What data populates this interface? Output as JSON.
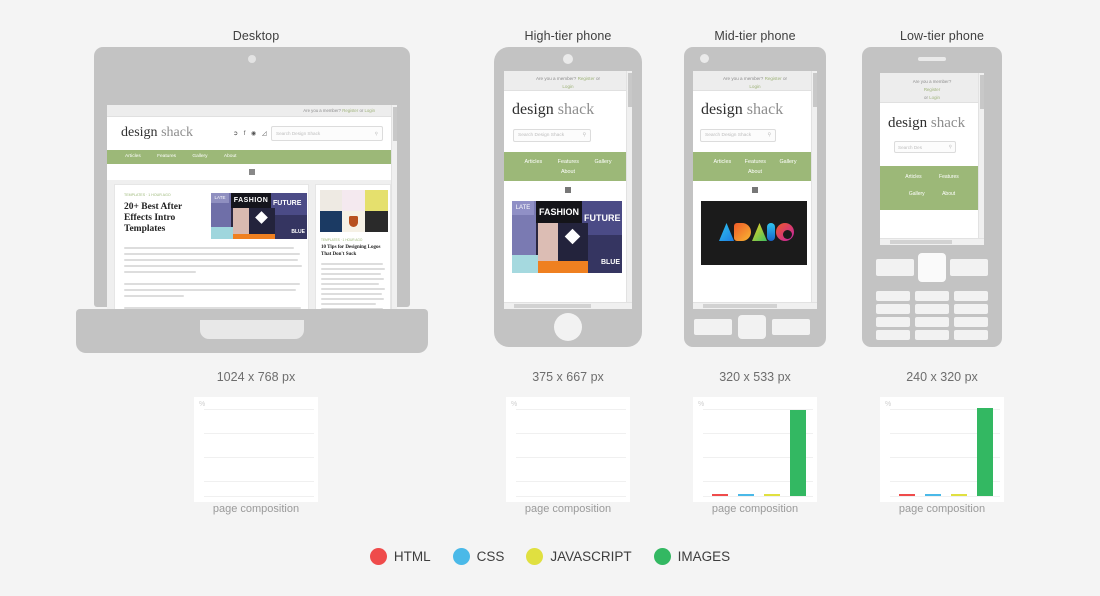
{
  "columns": [
    {
      "title": "Desktop",
      "size": "1024 x 768 px"
    },
    {
      "title": "High-tier phone",
      "size": "375 x 667 px"
    },
    {
      "title": "Mid-tier phone",
      "size": "320 x 533 px"
    },
    {
      "title": "Low-tier phone",
      "size": "240 x 320 px"
    }
  ],
  "site": {
    "topbar_text": "Are you a member?",
    "register_label": "Register",
    "or_label": "or",
    "login_label": "Login",
    "logo_first": "design",
    "logo_second": "shack",
    "search_placeholder": "Search Design Shack",
    "search_placeholder_short": "Search Des",
    "search_icon": "search-icon",
    "nav": [
      "Articles",
      "Features",
      "Gallery",
      "About"
    ],
    "social_icons": [
      "twitter-icon",
      "facebook-icon",
      "google-plus-icon",
      "rss-icon"
    ],
    "articles": [
      {
        "kicker": "TEMPLATES · 1 HOUR AGO",
        "headline": "20+ Best After Effects Intro Templates"
      },
      {
        "kicker": "TEMPLATES · 1 HOUR AGO",
        "headline": "10 Tips for Designing Logos That Don't Suck"
      }
    ],
    "collage_words": [
      "FASHION",
      "FUTURE",
      "LATE",
      "BLUE"
    ],
    "mid_image_caption": "ASVIO"
  },
  "legend": [
    {
      "label": "HTML",
      "color": "#ef4b4b"
    },
    {
      "label": "CSS",
      "color": "#4ab9e8"
    },
    {
      "label": "JAVASCRIPT",
      "color": "#e0e040"
    },
    {
      "label": "IMAGES",
      "color": "#33b862"
    }
  ],
  "chart_caption": "page composition",
  "chart_ylabel": "%",
  "chart_data": [
    {
      "type": "bar",
      "title": "Desktop",
      "categories": [
        "HTML",
        "CSS",
        "JAVASCRIPT",
        "IMAGES"
      ],
      "values": [
        0,
        0,
        0,
        0
      ],
      "colors": [
        "#ef4b4b",
        "#4ab9e8",
        "#e0e040",
        "#33b862"
      ],
      "xlabel": "page composition",
      "ylabel": "%",
      "ylim": [
        0,
        100
      ],
      "grid": true,
      "legend_position": "bottom"
    },
    {
      "type": "bar",
      "title": "High-tier phone",
      "categories": [
        "HTML",
        "CSS",
        "JAVASCRIPT",
        "IMAGES"
      ],
      "values": [
        0,
        0,
        0,
        0
      ],
      "colors": [
        "#ef4b4b",
        "#4ab9e8",
        "#e0e040",
        "#33b862"
      ],
      "xlabel": "page composition",
      "ylabel": "%",
      "ylim": [
        0,
        100
      ],
      "grid": true,
      "legend_position": "bottom"
    },
    {
      "type": "bar",
      "title": "Mid-tier phone",
      "categories": [
        "HTML",
        "CSS",
        "JAVASCRIPT",
        "IMAGES"
      ],
      "values": [
        1,
        1,
        2,
        95
      ],
      "colors": [
        "#ef4b4b",
        "#4ab9e8",
        "#e0e040",
        "#33b862"
      ],
      "xlabel": "page composition",
      "ylabel": "%",
      "ylim": [
        0,
        100
      ],
      "grid": true,
      "legend_position": "bottom"
    },
    {
      "type": "bar",
      "title": "Low-tier phone",
      "categories": [
        "HTML",
        "CSS",
        "JAVASCRIPT",
        "IMAGES"
      ],
      "values": [
        1,
        2,
        2,
        97
      ],
      "colors": [
        "#ef4b4b",
        "#4ab9e8",
        "#e0e040",
        "#33b862"
      ],
      "xlabel": "page composition",
      "ylabel": "%",
      "ylim": [
        0,
        100
      ],
      "grid": true,
      "legend_position": "bottom"
    }
  ]
}
